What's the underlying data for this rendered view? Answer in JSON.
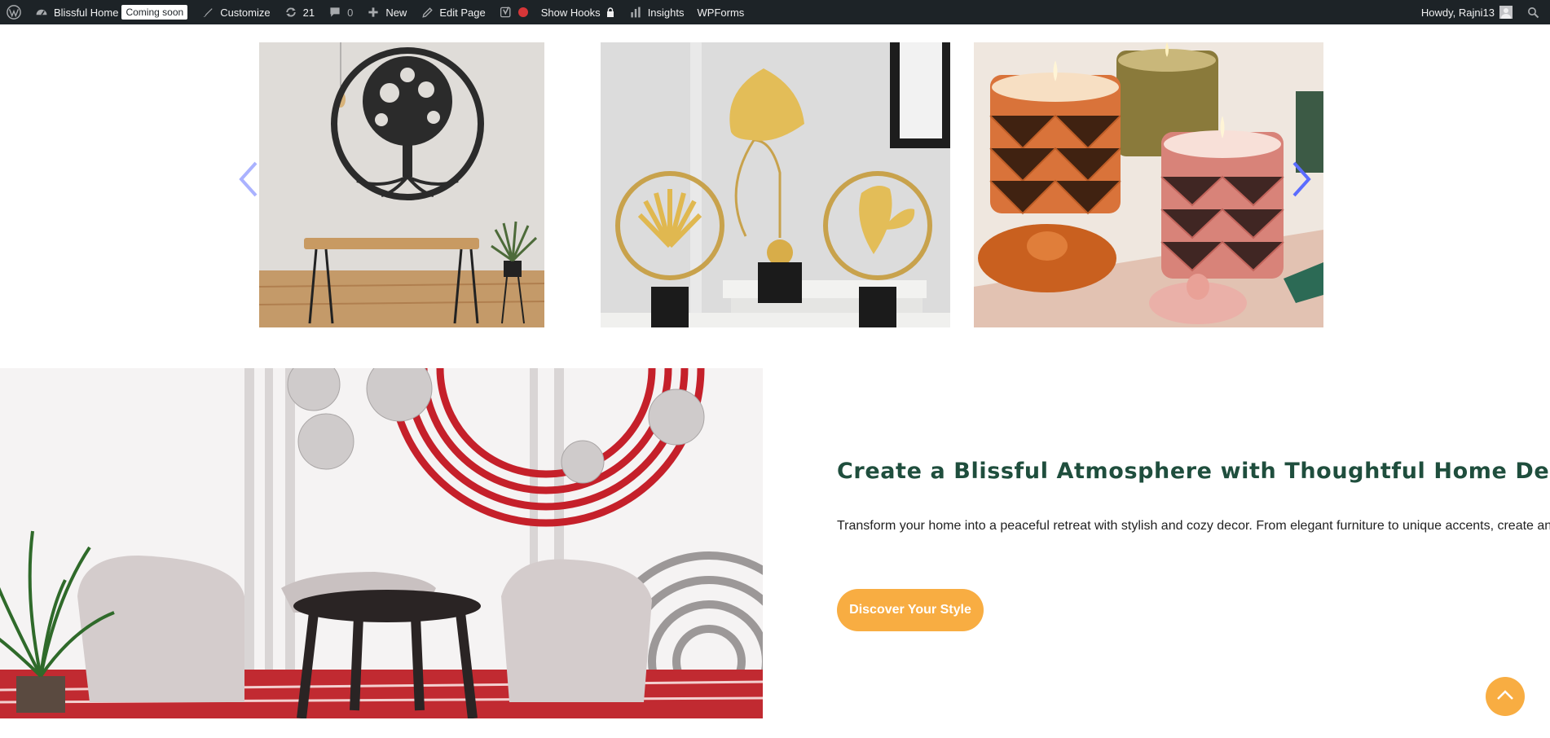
{
  "adminbar": {
    "site_name": "Blissful Home",
    "coming_soon": "Coming soon",
    "customize": "Customize",
    "updates_count": "21",
    "comments_count": "0",
    "new_label": "New",
    "edit_page": "Edit Page",
    "show_hooks": "Show Hooks",
    "insights": "Insights",
    "wpforms": "WPForms",
    "howdy": "Howdy, Rajni13"
  },
  "feature": {
    "title": "Create a Blissful Atmosphere with Thoughtful Home Decor",
    "text": "Transform your home into a peaceful retreat with stylish and cozy decor. From elegant furniture to unique accents, create an",
    "cta_label": "Discover Your Style"
  },
  "colors": {
    "adminbar_bg": "#1d2327",
    "heading_green": "#1f4e3d",
    "accent_orange": "#f8ad42",
    "arrow_blue": "#5b6cff"
  },
  "icons": {
    "wp": "wordpress-logo-icon",
    "dashboard": "dashboard-icon",
    "brush": "brush-icon",
    "updates": "refresh-icon",
    "comments": "comment-icon",
    "plus": "plus-icon",
    "pencil": "pencil-icon",
    "yoast": "yoast-icon",
    "lock": "lock-icon",
    "insights": "bar-chart-icon",
    "search": "search-icon",
    "prev": "chevron-left-icon",
    "next": "chevron-right-icon",
    "top": "chevron-up-icon"
  }
}
